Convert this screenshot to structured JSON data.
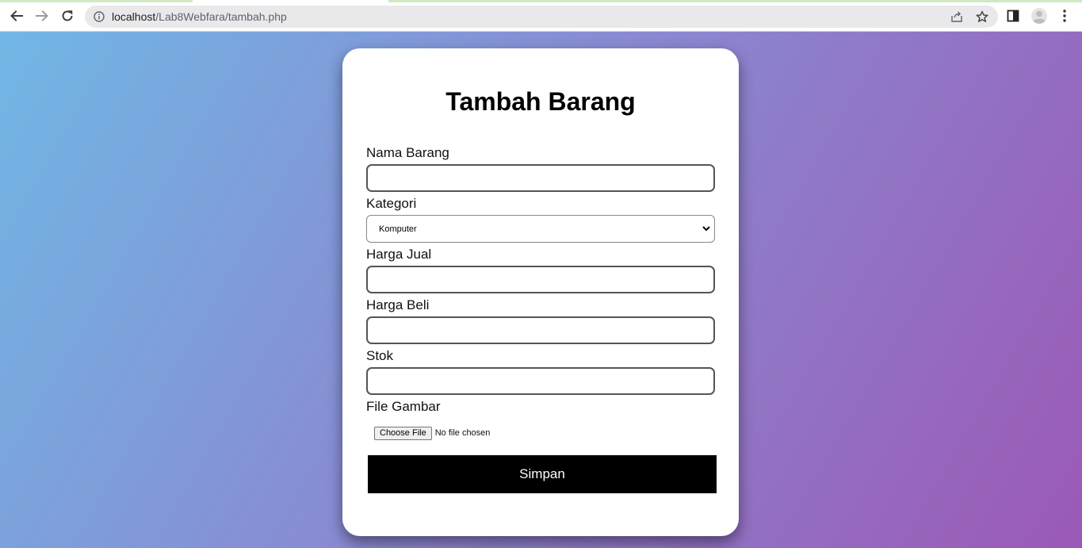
{
  "browser": {
    "url_host": "localhost",
    "url_path": "/Lab8Webfara/tambah.php"
  },
  "form": {
    "title": "Tambah Barang",
    "fields": {
      "nama_barang": {
        "label": "Nama Barang",
        "value": ""
      },
      "kategori": {
        "label": "Kategori",
        "selected": "Komputer"
      },
      "harga_jual": {
        "label": "Harga Jual",
        "value": ""
      },
      "harga_beli": {
        "label": "Harga Beli",
        "value": ""
      },
      "stok": {
        "label": "Stok",
        "value": ""
      },
      "file_gambar": {
        "label": "File Gambar",
        "button": "Choose File",
        "status": "No file chosen"
      }
    },
    "submit_label": "Simpan"
  },
  "colors": {
    "gradient_start": "#71b7e6",
    "gradient_end": "#9b59b6",
    "button_bg": "#000000",
    "button_text": "#ffffff"
  },
  "icons": [
    "back-icon",
    "forward-icon",
    "reload-icon",
    "site-info-icon",
    "share-icon",
    "bookmark-star-icon",
    "side-panel-icon",
    "profile-avatar-icon",
    "more-menu-icon"
  ]
}
